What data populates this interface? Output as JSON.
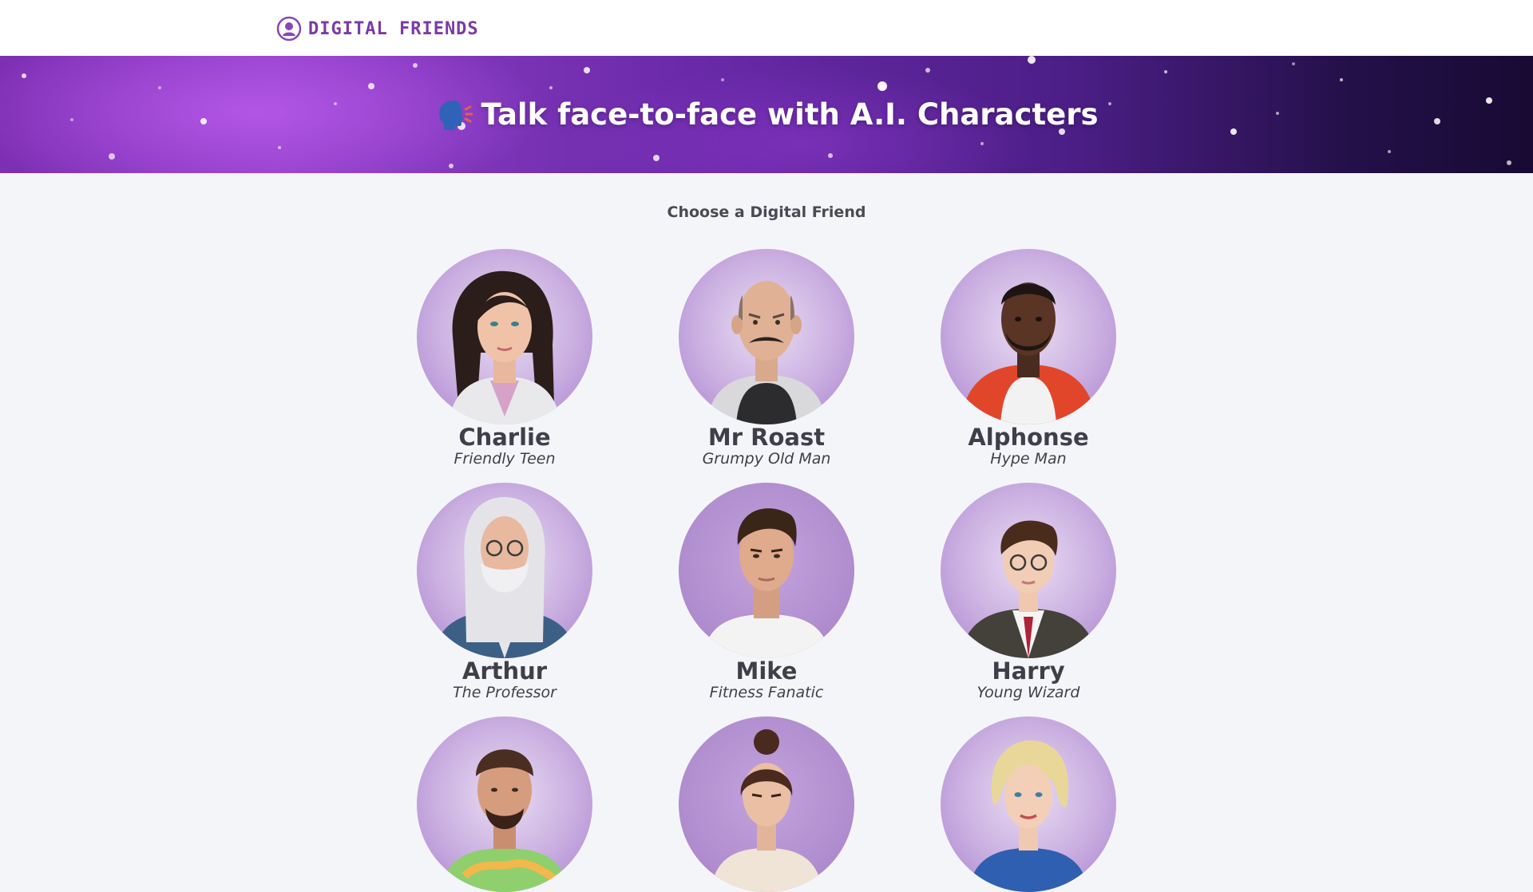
{
  "header": {
    "brand": "DIGITAL FRIENDS",
    "brand_color": "#7a3aa8",
    "logo_icon": "friend-logo-icon"
  },
  "banner": {
    "icon": "speaking-head-icon",
    "title": "Talk face-to-face with A.I. Characters"
  },
  "main": {
    "heading": "Choose a Digital Friend",
    "characters": [
      {
        "name": "Charlie",
        "role": "Friendly Teen"
      },
      {
        "name": "Mr Roast",
        "role": "Grumpy Old Man"
      },
      {
        "name": "Alphonse",
        "role": "Hype Man"
      },
      {
        "name": "Arthur",
        "role": "The Professor"
      },
      {
        "name": "Mike",
        "role": "Fitness Fanatic"
      },
      {
        "name": "Harry",
        "role": "Young Wizard"
      },
      {
        "name": "",
        "role": ""
      },
      {
        "name": "",
        "role": ""
      },
      {
        "name": "",
        "role": ""
      }
    ]
  },
  "colors": {
    "page_background": "#f4f5f9",
    "avatar_background": "#c9aee0",
    "text": "#3f3f4a"
  }
}
